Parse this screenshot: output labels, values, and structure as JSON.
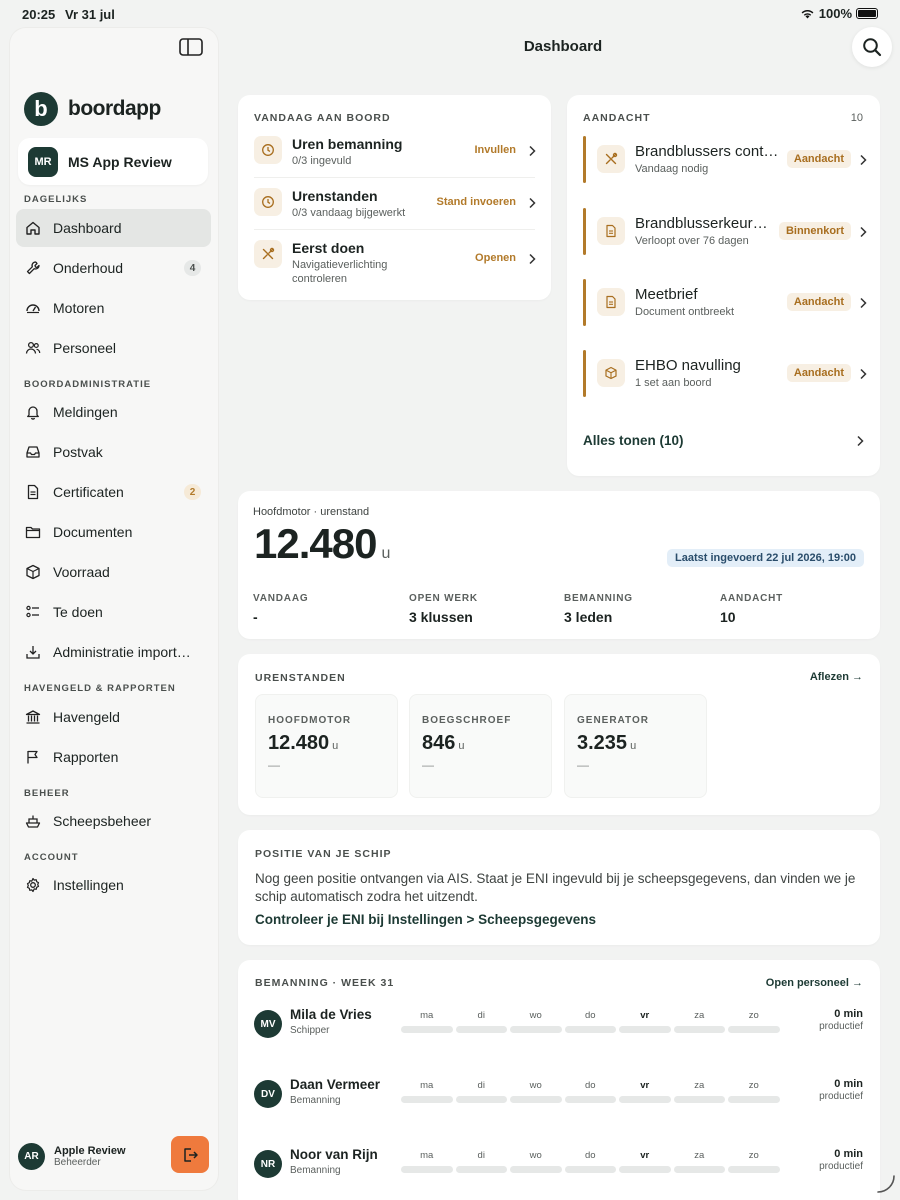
{
  "status": {
    "time": "20:25",
    "date": "Vr 31 jul",
    "battery": "100%"
  },
  "app": {
    "name": "boordapp",
    "logo_letter": "b",
    "title": "Dashboard"
  },
  "account": {
    "initials": "MR",
    "name": "MS App Review"
  },
  "sidebar": {
    "sections": {
      "daily": "DAGELIJKS",
      "admin": "BOORDADMINISTRATIE",
      "harbour": "HAVENGELD & RAPPORTEN",
      "manage": "BEHEER",
      "account": "ACCOUNT"
    },
    "items": {
      "dashboard": "Dashboard",
      "onderhoud": "Onderhoud",
      "onderhoud_badge": "4",
      "motoren": "Motoren",
      "personeel": "Personeel",
      "meldingen": "Meldingen",
      "postvak": "Postvak",
      "certificaten": "Certificaten",
      "certificaten_badge": "2",
      "documenten": "Documenten",
      "voorraad": "Voorraad",
      "tedoen": "Te doen",
      "import": "Administratie import…",
      "havengeld": "Havengeld",
      "rapporten": "Rapporten",
      "scheepsbeheer": "Scheepsbeheer",
      "instellingen": "Instellingen"
    },
    "user": {
      "initials": "AR",
      "name": "Apple Review",
      "role": "Beheerder"
    }
  },
  "vandaag": {
    "heading": "VANDAAG AAN BOORD",
    "rows": [
      {
        "title": "Uren bemanning",
        "sub": "0/3 ingevuld",
        "action": "Invullen",
        "icon": "clock-icon"
      },
      {
        "title": "Urenstanden",
        "sub": "0/3 vandaag bijgewerkt",
        "action": "Stand invoeren",
        "icon": "clock-icon"
      },
      {
        "title": "Eerst doen",
        "sub": "Navigatieverlichting controleren",
        "action": "Openen",
        "icon": "tools-icon"
      }
    ]
  },
  "aandacht": {
    "heading": "AANDACHT",
    "count": "10",
    "rows": [
      {
        "title": "Brandblussers controleren",
        "sub": "Vandaag nodig",
        "pill": "Aandacht",
        "icon": "tools-icon"
      },
      {
        "title": "Brandblusserkeuring",
        "sub": "Verloopt over 76 dagen",
        "pill": "Binnenkort",
        "icon": "document-icon"
      },
      {
        "title": "Meetbrief",
        "sub": "Document ontbreekt",
        "pill": "Aandacht",
        "icon": "document-icon"
      },
      {
        "title": "EHBO navulling",
        "sub": "1 set aan boord",
        "pill": "Aandacht",
        "icon": "box-icon"
      }
    ],
    "show_all": "Alles tonen (10)"
  },
  "motor": {
    "label": "Hoofdmotor · urenstand",
    "value": "12.480",
    "unit": "u",
    "last_entry": "Laatst ingevoerd 22 jul 2026, 19:00",
    "stats": [
      {
        "label": "VANDAAG",
        "value": "-"
      },
      {
        "label": "OPEN WERK",
        "value": "3 klussen"
      },
      {
        "label": "BEMANNING",
        "value": "3 leden"
      },
      {
        "label": "AANDACHT",
        "value": "10"
      }
    ]
  },
  "urenstanden": {
    "heading": "URENSTANDEN",
    "link": "Aflezen →",
    "items": [
      {
        "label": "HOOFDMOTOR",
        "value": "12.480",
        "unit": "u",
        "delta": "—"
      },
      {
        "label": "BOEGSCHROEF",
        "value": "846",
        "unit": "u",
        "delta": "—"
      },
      {
        "label": "GENERATOR",
        "value": "3.235",
        "unit": "u",
        "delta": "—"
      }
    ]
  },
  "positie": {
    "heading": "POSITIE VAN JE SCHIP",
    "text": "Nog geen positie ontvangen via AIS. Staat je ENI ingevuld bij je scheepsgegevens, dan vinden we je schip automatisch zodra het uitzendt.",
    "link": "Controleer je ENI bij Instellingen > Scheepsgegevens"
  },
  "bemanning": {
    "heading": "BEMANNING · WEEK 31",
    "link": "Open personeel →",
    "days": [
      "ma",
      "di",
      "wo",
      "do",
      "vr",
      "za",
      "zo"
    ],
    "today_index": 4,
    "members": [
      {
        "initials": "MV",
        "name": "Mila de Vries",
        "role": "Schipper",
        "minutes": "0 min",
        "label": "productief"
      },
      {
        "initials": "DV",
        "name": "Daan Vermeer",
        "role": "Bemanning",
        "minutes": "0 min",
        "label": "productief"
      },
      {
        "initials": "NR",
        "name": "Noor van Rijn",
        "role": "Bemanning",
        "minutes": "0 min",
        "label": "productief"
      }
    ]
  },
  "colors": {
    "brand": "#1d3a34",
    "accent": "#b27a2a",
    "logout": "#ef7a3d",
    "info_pill": "#e3eef8"
  }
}
